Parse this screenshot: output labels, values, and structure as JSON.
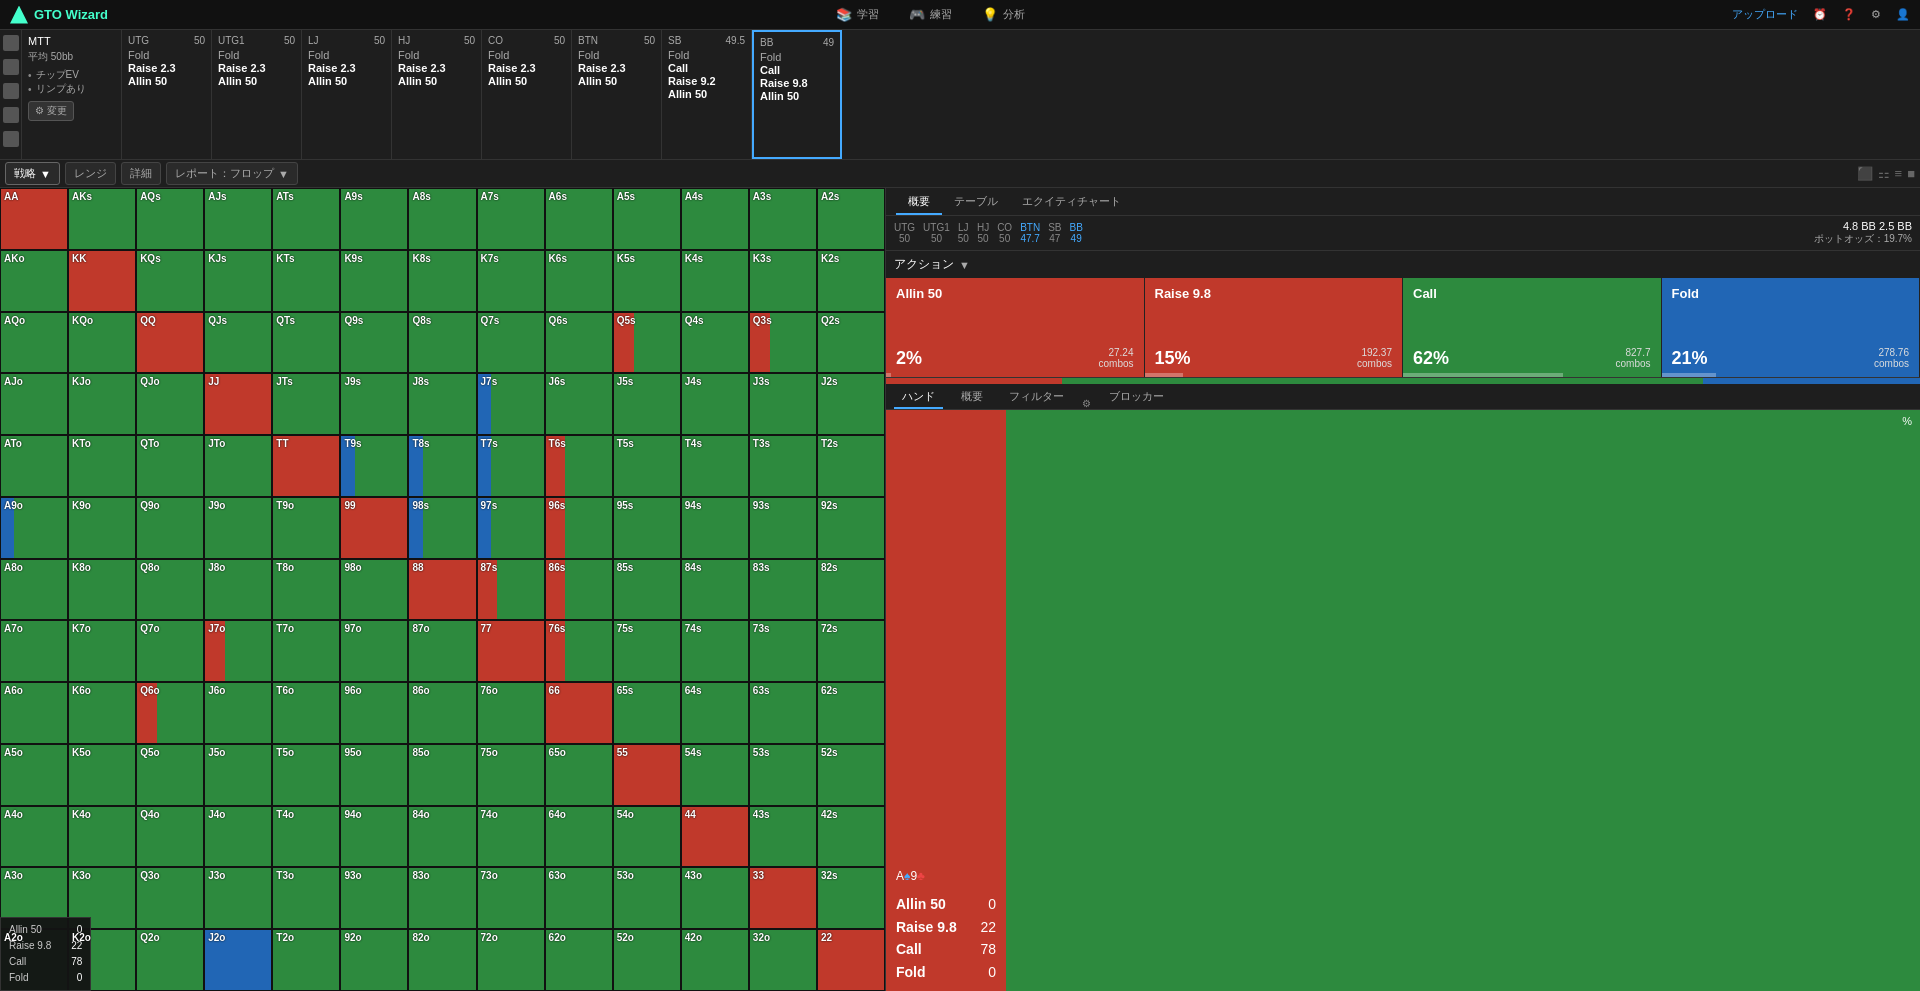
{
  "app": {
    "title": "GTO Wizard",
    "logo_icon": "W"
  },
  "topnav": {
    "study": "学習",
    "practice": "練習",
    "analyze": "分析",
    "upload": "アップロード",
    "study_icon": "📚",
    "practice_icon": "🎮",
    "analyze_icon": "💡"
  },
  "mtt_section": {
    "label": "MTT",
    "avg_label": "平均 50bb",
    "chip_ev": "チップEV",
    "limp": "リンプあり",
    "change_btn": "変更"
  },
  "positions": [
    {
      "name": "UTG",
      "stack": "50",
      "actions": [
        "Fold",
        "Raise 2.3",
        "Allin 50"
      ],
      "active": false
    },
    {
      "name": "UTG1",
      "stack": "50",
      "actions": [
        "Fold",
        "Raise 2.3",
        "Allin 50"
      ],
      "active": false
    },
    {
      "name": "LJ",
      "stack": "50",
      "actions": [
        "Fold",
        "Raise 2.3",
        "Allin 50"
      ],
      "active": false
    },
    {
      "name": "HJ",
      "stack": "50",
      "actions": [
        "Fold",
        "Raise 2.3",
        "Allin 50"
      ],
      "active": false
    },
    {
      "name": "CO",
      "stack": "50",
      "actions": [
        "Fold",
        "Raise 2.3",
        "Allin 50"
      ],
      "active": false
    },
    {
      "name": "BTN",
      "stack": "50",
      "actions": [
        "Fold",
        "Raise 2.3",
        "Allin 50"
      ],
      "active": false
    },
    {
      "name": "SB",
      "stack": "49.5",
      "actions": [
        "Fold",
        "Call",
        "Raise 9.2",
        "Allin 50"
      ],
      "active": false
    },
    {
      "name": "BB",
      "stack": "49",
      "actions": [
        "Fold",
        "Call",
        "Raise 9.8",
        "Allin 50"
      ],
      "active": true
    }
  ],
  "tabs": {
    "strategy": "戦略",
    "range": "レンジ",
    "detail": "詳細",
    "report": "レポート：フロップ"
  },
  "right_panel": {
    "tabs": [
      "概要",
      "テーブル",
      "エクイティチャート"
    ],
    "active_tab": "概要",
    "pos_summary": {
      "utg": {
        "name": "UTG",
        "stack": "50"
      },
      "utg1": {
        "name": "UTG1",
        "stack": "50"
      },
      "lj": {
        "name": "LJ",
        "stack": "50"
      },
      "hj": {
        "name": "HJ",
        "stack": "50"
      },
      "co": {
        "name": "CO",
        "stack": "50"
      },
      "btn": {
        "name": "BTN",
        "stack": "47.7"
      },
      "sb": {
        "name": "SB",
        "stack": "47"
      },
      "bb": {
        "name": "BB",
        "stack": "49"
      },
      "bb_size": "4.8 BB",
      "sb_size": "2.5 BB",
      "pot_odds": "ポットオッズ：19.7%"
    },
    "action_label": "アクション",
    "actions": [
      {
        "name": "Allin 50",
        "pct": "2%",
        "combos": "27.24",
        "combo_label": "combos",
        "bar_pct": 2
      },
      {
        "name": "Raise 9.8",
        "pct": "15%",
        "combos": "192.37",
        "combo_label": "combos",
        "bar_pct": 15
      },
      {
        "name": "Call",
        "pct": "62%",
        "combos": "827.7",
        "combo_label": "combos",
        "bar_pct": 62
      },
      {
        "name": "Fold",
        "pct": "21%",
        "combos": "278.76",
        "combo_label": "combos",
        "bar_pct": 21
      }
    ],
    "hand_tabs": [
      "ハンド",
      "概要",
      "フィルター",
      "ブロッカー"
    ],
    "active_hand_tab": "ハンド",
    "selected_cards": "A♠9♣",
    "hand_detail": {
      "actions": [
        "Allin 50",
        "Raise 9.8",
        "Call",
        "Fold"
      ],
      "values": [
        0,
        22,
        78,
        0
      ]
    }
  },
  "legend": {
    "items": [
      "Allin 50",
      "Raise 9.8",
      "Call",
      "Fold"
    ],
    "values": [
      0,
      22,
      78,
      0
    ]
  },
  "matrix": {
    "rows": [
      [
        "AA",
        "AKs",
        "AQs",
        "AJs",
        "ATs",
        "A9s",
        "A8s",
        "A7s",
        "A6s",
        "A5s",
        "A4s",
        "A3s",
        "A2s"
      ],
      [
        "AKo",
        "KK",
        "KQs",
        "KJs",
        "KTs",
        "K9s",
        "K8s",
        "K7s",
        "K6s",
        "K5s",
        "K4s",
        "K3s",
        "K2s"
      ],
      [
        "AQo",
        "KQo",
        "QQ",
        "QJs",
        "QTs",
        "Q9s",
        "Q8s",
        "Q7s",
        "Q6s",
        "Q5s",
        "Q4s",
        "Q3s",
        "Q2s"
      ],
      [
        "AJo",
        "KJo",
        "QJo",
        "JJ",
        "JTs",
        "J9s",
        "J8s",
        "J7s",
        "J6s",
        "J5s",
        "J4s",
        "J3s",
        "J2s"
      ],
      [
        "ATo",
        "KTo",
        "QTo",
        "JTo",
        "TT",
        "T9s",
        "T8s",
        "T7s",
        "T6s",
        "T5s",
        "T4s",
        "T3s",
        "T2s"
      ],
      [
        "A9o",
        "K9o",
        "Q9o",
        "J9o",
        "T9o",
        "99",
        "98s",
        "97s",
        "96s",
        "95s",
        "94s",
        "93s",
        "92s"
      ],
      [
        "A8o",
        "K8o",
        "Q8o",
        "J8o",
        "T8o",
        "98o",
        "88",
        "87s",
        "86s",
        "85s",
        "84s",
        "83s",
        "82s"
      ],
      [
        "A7o",
        "K7o",
        "Q7o",
        "J7o",
        "T7o",
        "97o",
        "87o",
        "77",
        "76s",
        "75s",
        "74s",
        "73s",
        "72s"
      ],
      [
        "A6o",
        "K6o",
        "Q6o",
        "J6o",
        "T6o",
        "96o",
        "86o",
        "76o",
        "66",
        "65s",
        "64s",
        "63s",
        "62s"
      ],
      [
        "A5o",
        "K5o",
        "Q5o",
        "J5o",
        "T5o",
        "95o",
        "85o",
        "75o",
        "65o",
        "55",
        "54s",
        "53s",
        "52s"
      ],
      [
        "A4o",
        "K4o",
        "Q4o",
        "J4o",
        "T4o",
        "94o",
        "84o",
        "74o",
        "64o",
        "54o",
        "44",
        "43s",
        "42s"
      ],
      [
        "A3o",
        "K3o",
        "Q3o",
        "J3o",
        "T3o",
        "93o",
        "83o",
        "73o",
        "63o",
        "53o",
        "43o",
        "33",
        "32s"
      ],
      [
        "A2o",
        "K2o",
        "Q2o",
        "J2o",
        "T2o",
        "92o",
        "82o",
        "72o",
        "62o",
        "52o",
        "42o",
        "32o",
        "22"
      ]
    ],
    "colors": [
      [
        "red",
        "green",
        "green",
        "green",
        "green",
        "green",
        "green",
        "green",
        "green",
        "green",
        "green",
        "green",
        "green"
      ],
      [
        "green",
        "red",
        "green",
        "green",
        "green",
        "green",
        "green",
        "green",
        "green",
        "green",
        "green",
        "green",
        "green"
      ],
      [
        "green",
        "green",
        "red",
        "green",
        "green",
        "green",
        "green",
        "green",
        "green",
        "mixed_r",
        "green",
        "mixed_r",
        "green"
      ],
      [
        "green",
        "green",
        "green",
        "red",
        "green",
        "green",
        "green",
        "mixed_g",
        "green",
        "green",
        "green",
        "green",
        "green"
      ],
      [
        "green",
        "green",
        "green",
        "green",
        "red",
        "mixed_g",
        "mixed_g",
        "mixed_g",
        "mixed_r",
        "green",
        "green",
        "green",
        "green"
      ],
      [
        "mixed_g",
        "green",
        "green",
        "green",
        "green",
        "red",
        "mixed_g",
        "mixed_g",
        "mixed_r",
        "green",
        "green",
        "green",
        "green"
      ],
      [
        "green",
        "green",
        "green",
        "green",
        "green",
        "green",
        "red",
        "mixed_r",
        "mixed_r",
        "green",
        "green",
        "green",
        "green"
      ],
      [
        "green",
        "green",
        "green",
        "mixed_r",
        "green",
        "green",
        "green",
        "red",
        "mixed_r",
        "green",
        "green",
        "green",
        "green"
      ],
      [
        "green",
        "green",
        "mixed_r",
        "green",
        "green",
        "green",
        "green",
        "green",
        "red",
        "green",
        "green",
        "green",
        "green"
      ],
      [
        "green",
        "green",
        "green",
        "green",
        "green",
        "green",
        "green",
        "green",
        "green",
        "red",
        "green",
        "green",
        "green"
      ],
      [
        "green",
        "green",
        "green",
        "green",
        "green",
        "green",
        "green",
        "green",
        "green",
        "green",
        "red",
        "green",
        "green"
      ],
      [
        "green",
        "green",
        "green",
        "green",
        "green",
        "green",
        "green",
        "green",
        "green",
        "green",
        "green",
        "red",
        "green"
      ],
      [
        "green",
        "green",
        "green",
        "blue",
        "green",
        "green",
        "green",
        "green",
        "green",
        "green",
        "green",
        "green",
        "red"
      ]
    ]
  }
}
